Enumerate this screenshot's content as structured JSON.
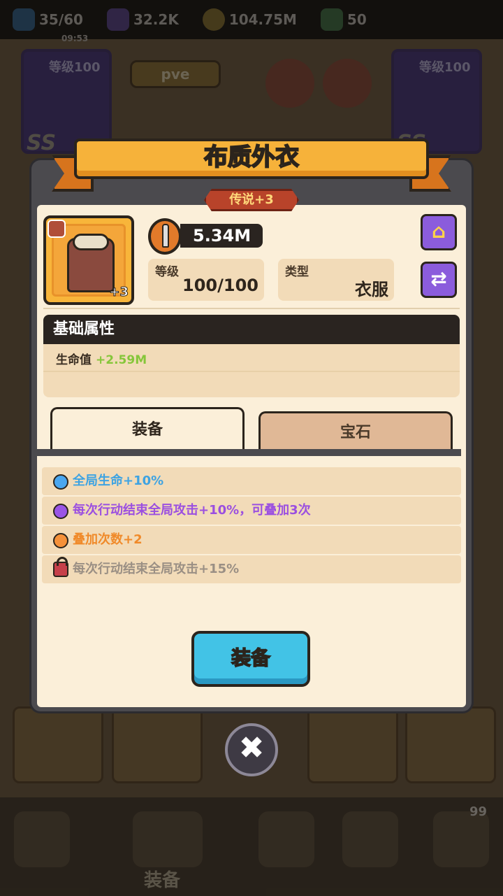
{
  "top_resources": {
    "energy": "35/60",
    "energy_timer": "09:53",
    "gems": "32.2K",
    "coins": "104.75M",
    "tickets": "50"
  },
  "background": {
    "left_card_level": "等级100",
    "right_card_level": "等级100",
    "left_card_rank": "SS",
    "right_card_rank": "SS",
    "mode_label": "pve",
    "bottom_nav_label": "装备",
    "notif_count": "99"
  },
  "modal": {
    "title": "布质外衣",
    "rarity": "传说+3",
    "item_plus": "+3",
    "power": "5.34M",
    "level_label": "等级",
    "level_value": "100/100",
    "type_label": "类型",
    "type_value": "衣服",
    "base_attr_title": "基础属性",
    "base_attr_name": "生命值",
    "base_attr_value": "+2.59M",
    "tabs": [
      {
        "label": "装备",
        "active": true
      },
      {
        "label": "宝石",
        "active": false
      }
    ],
    "skills": [
      {
        "text": "全局生命+10%",
        "color": "#3ea3e2",
        "dot": "#4aa7f0"
      },
      {
        "text": "每次行动结束全局攻击+10%，可叠加3次",
        "color": "#9b4fe0",
        "dot": "#9a55e6"
      },
      {
        "text": "叠加次数+2",
        "color": "#f08a2a",
        "dot": "#f5913a"
      },
      {
        "text": "每次行动结束全局攻击+15%",
        "color": "#9a8f84",
        "locked": true
      }
    ],
    "equip_button": "装备",
    "close_symbol": "✖"
  }
}
